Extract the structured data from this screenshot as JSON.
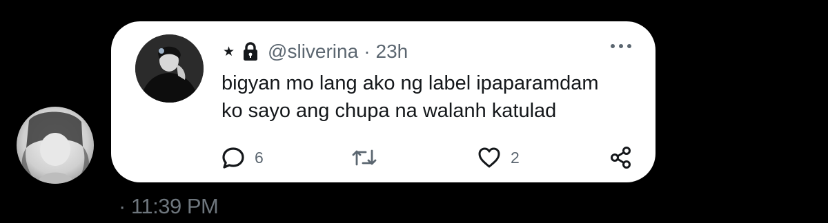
{
  "sender": {
    "avatar": "sender-avatar-photo"
  },
  "tweet": {
    "author_avatar": "author-avatar-photo",
    "star": "★",
    "separator": "·",
    "handle": "@sliverina",
    "time_ago": "23h",
    "more_icon": "more-horizontal-icon",
    "text_lines": [
      "bigyan mo lang ako ng label ipaparamdam",
      "ko sayo ang chupa na walanh katulad"
    ],
    "actions": {
      "reply_icon": "reply-bubble-icon",
      "reply_count": "6",
      "retweet_icon": "retweet-icon",
      "like_icon": "heart-icon",
      "like_count": "2",
      "share_icon": "share-icon"
    }
  },
  "message": {
    "timestamp": "· 11:39 PM"
  },
  "colors": {
    "background": "#000000",
    "bubble": "#ffffff",
    "text": "#14171a",
    "muted": "#5b6670",
    "timestamp": "#6e767d"
  }
}
